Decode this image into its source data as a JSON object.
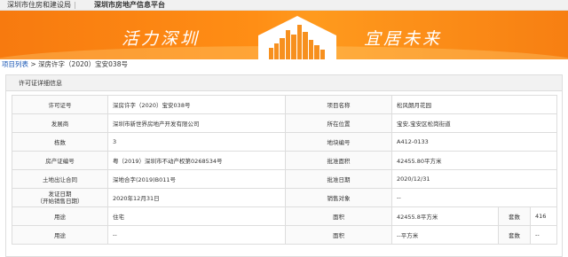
{
  "header": {
    "site_name": "深圳市住房和建设局",
    "platform_name": "深圳市房地产信息平台"
  },
  "banner": {
    "slogan_left": "活力深圳",
    "slogan_right": "宜居未来"
  },
  "breadcrumb": {
    "link_label": "项目列表",
    "separator": " > ",
    "current": "深房许字（2020）宝安038号"
  },
  "panel": {
    "title": "许可证详细信息"
  },
  "details": {
    "permit_no_label": "许可证号",
    "permit_no_value": "深房许字（2020）宝安038号",
    "project_name_label": "项目名称",
    "project_name_value": "松风朗月花园",
    "developer_label": "发展商",
    "developer_value": "深圳市新世界房地产开发有限公司",
    "location_label": "所在位置",
    "location_value": "宝安,宝安区松岗街道",
    "building_count_label": "栋数",
    "building_count_value": "3",
    "parcel_no_label": "地块编号",
    "parcel_no_value": "A412-0133",
    "property_cert_label": "房产证编号",
    "property_cert_value": "粤（2019）深圳市不动产权第0268534号",
    "approved_area_label": "批准面积",
    "approved_area_value": "42455.80平方米",
    "land_contract_label": "土地出让合同",
    "land_contract_value": "深地合字(2019)B011号",
    "approval_date_label": "批准日期",
    "approval_date_value": "2020/12/31",
    "issue_date_label_line1": "发证日期",
    "issue_date_label_line2": "（开始销售日期）",
    "issue_date_value": "2020年12月31日",
    "sales_target_label": "销售对象",
    "sales_target_value": "--"
  },
  "usage_rows": [
    {
      "usage_label": "用途",
      "usage_value": "住宅",
      "area_label": "面积",
      "area_value": "42455.8平方米",
      "units_label": "套数",
      "units_value": "416"
    },
    {
      "usage_label": "用途",
      "usage_value": "--",
      "area_label": "面积",
      "area_value": "--平方米",
      "units_label": "套数",
      "units_value": "--"
    }
  ],
  "colors": {
    "banner_orange": "#f77a0f",
    "link_blue": "#1a57b5"
  }
}
